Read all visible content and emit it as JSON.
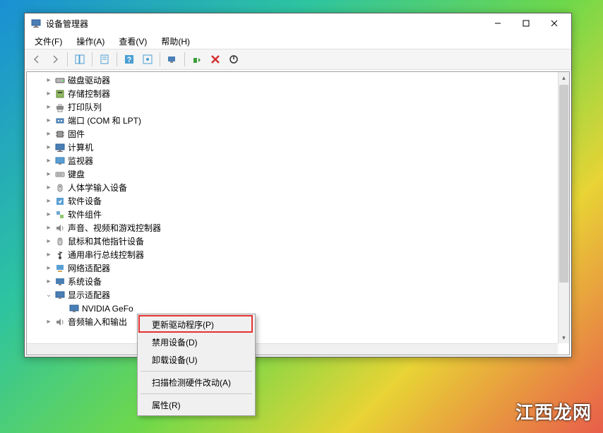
{
  "window": {
    "title": "设备管理器"
  },
  "menubar": {
    "file": "文件(F)",
    "action": "操作(A)",
    "view": "查看(V)",
    "help": "帮助(H)"
  },
  "tree": {
    "items": [
      {
        "label": "磁盘驱动器",
        "icon": "disk",
        "expander": "▸",
        "indent": 1
      },
      {
        "label": "存储控制器",
        "icon": "storage",
        "expander": "▸",
        "indent": 1
      },
      {
        "label": "打印队列",
        "icon": "printer",
        "expander": "▸",
        "indent": 1
      },
      {
        "label": "端口 (COM 和 LPT)",
        "icon": "port",
        "expander": "▸",
        "indent": 1
      },
      {
        "label": "固件",
        "icon": "firmware",
        "expander": "▸",
        "indent": 1
      },
      {
        "label": "计算机",
        "icon": "computer",
        "expander": "▸",
        "indent": 1
      },
      {
        "label": "监视器",
        "icon": "monitor",
        "expander": "▸",
        "indent": 1
      },
      {
        "label": "键盘",
        "icon": "keyboard",
        "expander": "▸",
        "indent": 1
      },
      {
        "label": "人体学输入设备",
        "icon": "hid",
        "expander": "▸",
        "indent": 1
      },
      {
        "label": "软件设备",
        "icon": "software",
        "expander": "▸",
        "indent": 1
      },
      {
        "label": "软件组件",
        "icon": "component",
        "expander": "▸",
        "indent": 1
      },
      {
        "label": "声音、视频和游戏控制器",
        "icon": "sound",
        "expander": "▸",
        "indent": 1
      },
      {
        "label": "鼠标和其他指针设备",
        "icon": "mouse",
        "expander": "▸",
        "indent": 1
      },
      {
        "label": "通用串行总线控制器",
        "icon": "usb",
        "expander": "▸",
        "indent": 1
      },
      {
        "label": "网络适配器",
        "icon": "network",
        "expander": "▸",
        "indent": 1
      },
      {
        "label": "系统设备",
        "icon": "system",
        "expander": "▸",
        "indent": 1
      },
      {
        "label": "显示适配器",
        "icon": "display",
        "expander": "⌄",
        "indent": 1
      },
      {
        "label": "NVIDIA GeFo",
        "icon": "gpu",
        "expander": "",
        "indent": 2
      },
      {
        "label": "音频输入和输出",
        "icon": "audio",
        "expander": "▸",
        "indent": 1
      }
    ]
  },
  "context_menu": {
    "update_driver": "更新驱动程序(P)",
    "disable": "禁用设备(D)",
    "uninstall": "卸载设备(U)",
    "scan": "扫描检测硬件改动(A)",
    "properties": "属性(R)"
  },
  "watermark": "江西龙网"
}
